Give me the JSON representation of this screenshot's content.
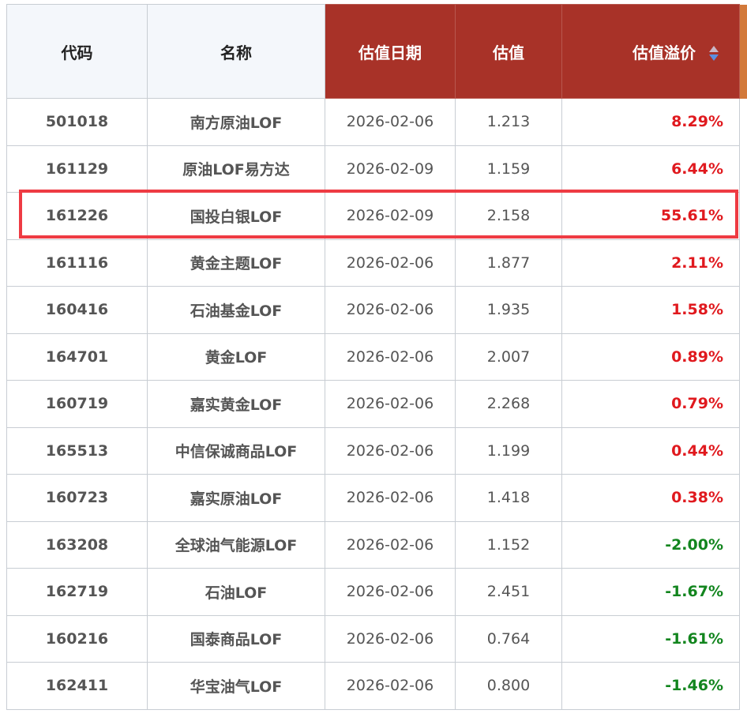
{
  "table": {
    "headers": {
      "code": "代码",
      "name": "名称",
      "date": "估值日期",
      "value": "估值",
      "premium": "估值溢价"
    },
    "sort_icon": "sort-up-down-icon",
    "colors": {
      "header_dark": "#a83228",
      "header_light": "#f4f7fb",
      "positive": "#e0191e",
      "negative": "#12851e",
      "highlight": "#ee3b43"
    },
    "rows": [
      {
        "code": "501018",
        "name": "南方原油LOF",
        "date": "2026-02-06",
        "value": "1.213",
        "premium": "8.29%"
      },
      {
        "code": "161129",
        "name": "原油LOF易方达",
        "date": "2026-02-09",
        "value": "1.159",
        "premium": "6.44%"
      },
      {
        "code": "161226",
        "name": "国投白银LOF",
        "date": "2026-02-09",
        "value": "2.158",
        "premium": "55.61%"
      },
      {
        "code": "161116",
        "name": "黄金主题LOF",
        "date": "2026-02-06",
        "value": "1.877",
        "premium": "2.11%"
      },
      {
        "code": "160416",
        "name": "石油基金LOF",
        "date": "2026-02-06",
        "value": "1.935",
        "premium": "1.58%"
      },
      {
        "code": "164701",
        "name": "黄金LOF",
        "date": "2026-02-06",
        "value": "2.007",
        "premium": "0.89%"
      },
      {
        "code": "160719",
        "name": "嘉实黄金LOF",
        "date": "2026-02-06",
        "value": "2.268",
        "premium": "0.79%"
      },
      {
        "code": "165513",
        "name": "中信保诚商品LOF",
        "date": "2026-02-06",
        "value": "1.199",
        "premium": "0.44%"
      },
      {
        "code": "160723",
        "name": "嘉实原油LOF",
        "date": "2026-02-06",
        "value": "1.418",
        "premium": "0.38%"
      },
      {
        "code": "163208",
        "name": "全球油气能源LOF",
        "date": "2026-02-06",
        "value": "1.152",
        "premium": "-2.00%"
      },
      {
        "code": "162719",
        "name": "石油LOF",
        "date": "2026-02-06",
        "value": "2.451",
        "premium": "-1.67%"
      },
      {
        "code": "160216",
        "name": "国泰商品LOF",
        "date": "2026-02-06",
        "value": "0.764",
        "premium": "-1.61%"
      },
      {
        "code": "162411",
        "name": "华宝油气LOF",
        "date": "2026-02-06",
        "value": "0.800",
        "premium": "-1.46%"
      }
    ]
  }
}
